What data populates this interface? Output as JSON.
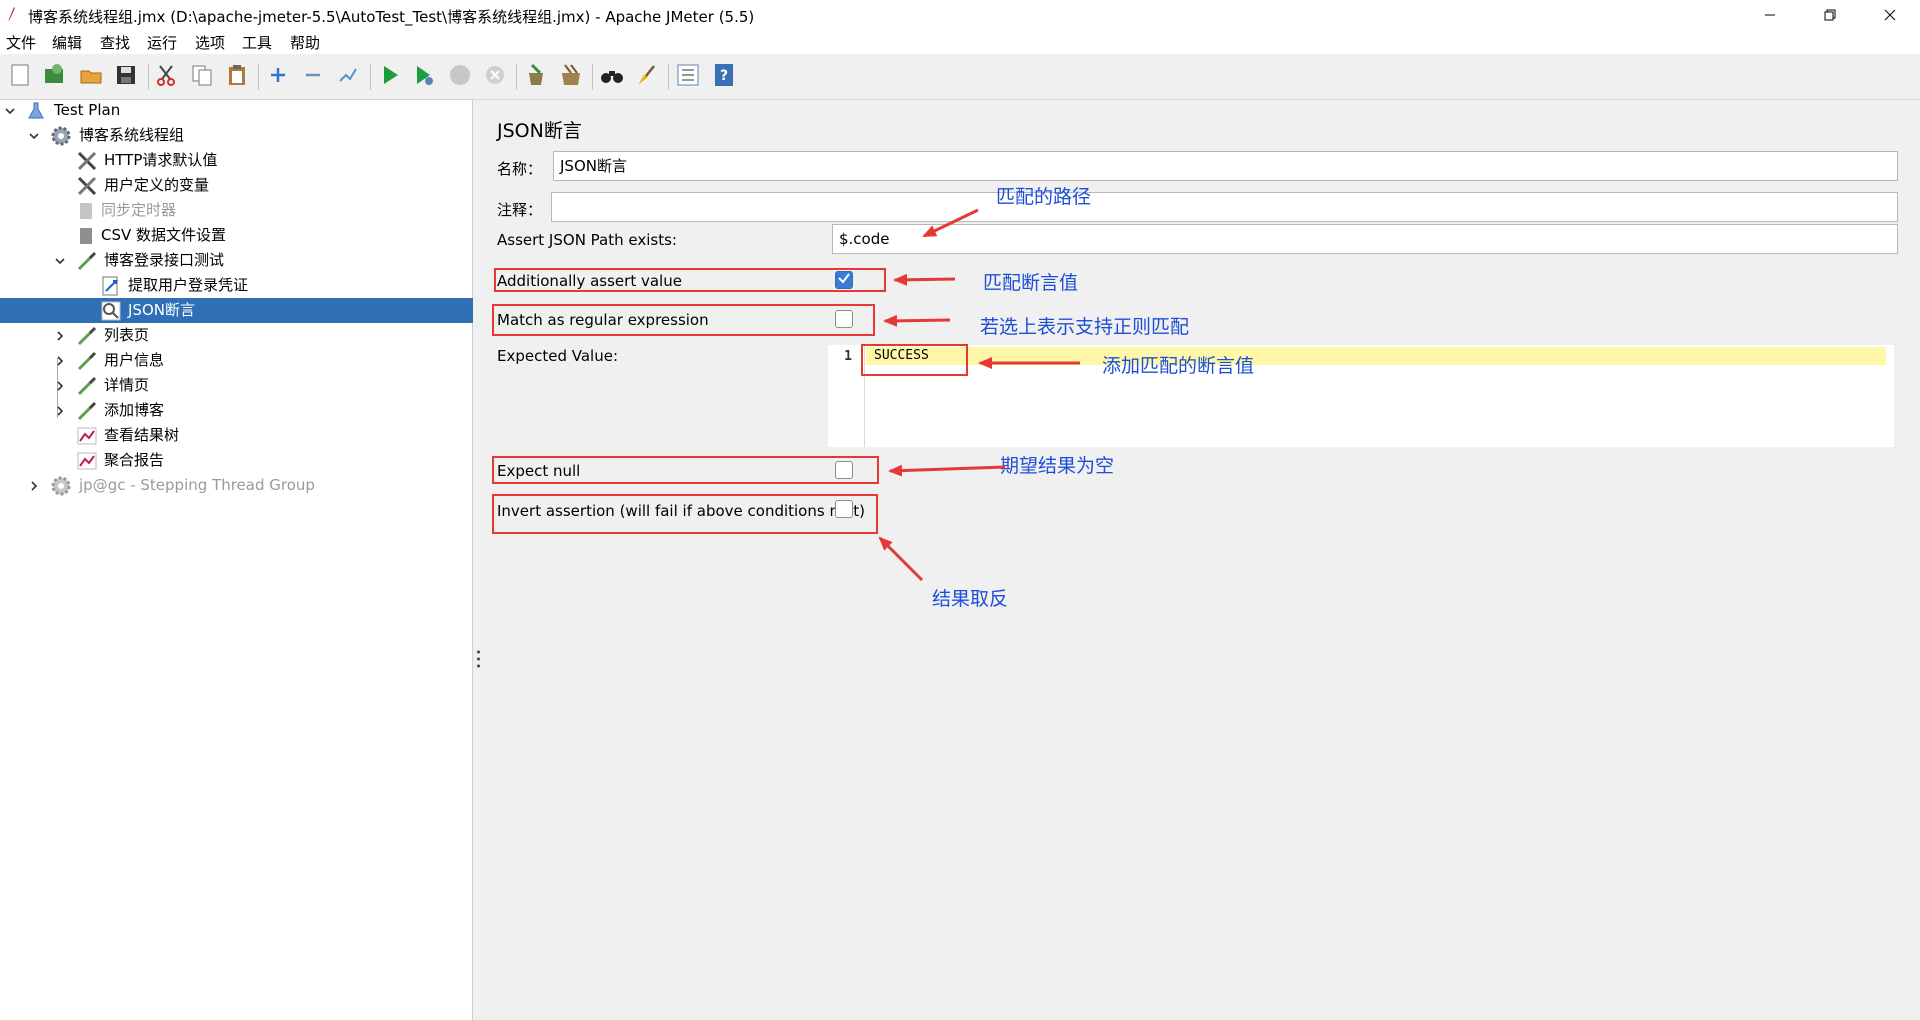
{
  "window": {
    "title": "博客系统线程组.jmx (D:\\apache-jmeter-5.5\\AutoTest_Test\\博客系统线程组.jmx) - Apache JMeter (5.5)"
  },
  "menu": [
    "文件",
    "编辑",
    "查找",
    "运行",
    "选项",
    "工具",
    "帮助"
  ],
  "toolbar": {
    "icons": [
      "new-icon",
      "templates-icon",
      "open-icon",
      "save-icon",
      "cut-icon",
      "copy-icon",
      "paste-icon",
      "expand-icon",
      "collapse-icon",
      "toggle-icon",
      "start-icon",
      "start-no-pause-icon",
      "stop-icon",
      "shutdown-icon",
      "clear-icon",
      "clear-all-icon",
      "search-icon",
      "reset-search-icon",
      "function-helper-icon",
      "help-icon"
    ]
  },
  "tree": {
    "nodes": [
      {
        "label": "Test Plan",
        "icon": "test-plan-icon"
      },
      {
        "label": "博客系统线程组",
        "icon": "thread-group-gear-icon"
      },
      {
        "label": "HTTP请求默认值",
        "icon": "config-tools-icon"
      },
      {
        "label": "用户定义的变量",
        "icon": "config-tools-icon"
      },
      {
        "label": "同步定时器",
        "icon": "timer-doc-icon"
      },
      {
        "label": "CSV 数据文件设置",
        "icon": "csv-doc-icon"
      },
      {
        "label": "博客登录接口测试",
        "icon": "http-sampler-pipette-icon"
      },
      {
        "label": "提取用户登录凭证",
        "icon": "extractor-arrow-icon"
      },
      {
        "label": "JSON断言",
        "icon": "assertion-magnifier-icon"
      },
      {
        "label": "列表页",
        "icon": "http-sampler-pipette-icon"
      },
      {
        "label": "用户信息",
        "icon": "http-sampler-pipette-icon"
      },
      {
        "label": "详情页",
        "icon": "http-sampler-pipette-icon"
      },
      {
        "label": "添加博客",
        "icon": "http-sampler-pipette-icon"
      },
      {
        "label": "查看结果树",
        "icon": "listener-chart-icon"
      },
      {
        "label": "聚合报告",
        "icon": "listener-chart-icon"
      },
      {
        "label": "jp@gc - Stepping Thread Group",
        "icon": "thread-group-gear-icon"
      }
    ]
  },
  "form": {
    "panel_title": "JSON断言",
    "name_label": "名称：",
    "name_value": "JSON断言",
    "comment_label": "注释：",
    "comment_value": "",
    "path_label": "Assert JSON Path exists:",
    "path_value": "$.code",
    "additionally_label": "Additionally assert value",
    "additionally_checked": true,
    "regex_label": "Match as regular expression",
    "regex_checked": false,
    "expected_label": "Expected Value:",
    "expected_line_no": "1",
    "expected_value": "SUCCESS",
    "expect_null_label": "Expect null",
    "expect_null_checked": false,
    "invert_label": "Invert assertion (will fail if above conditions met)",
    "invert_checked": false
  },
  "annotations": {
    "path": "匹配的路径",
    "assert_value": "匹配断言值",
    "regex": "若选上表示支持正则匹配",
    "expected": "添加匹配的断言值",
    "null": "期望结果为空",
    "invert": "结果取反"
  },
  "colors": {
    "selection": "#2f6fb6",
    "annotation_text": "#1e4ed8",
    "annotation_red": "#e53935",
    "current_line": "#fff7a8"
  }
}
